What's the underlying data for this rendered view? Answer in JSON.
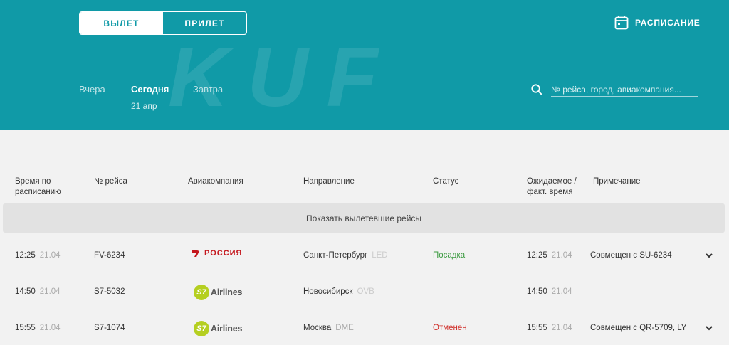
{
  "header": {
    "bg_logo": "KUF",
    "tabs": [
      {
        "label": "ВЫЛЕТ",
        "active": true
      },
      {
        "label": "ПРИЛЕТ",
        "active": false
      }
    ],
    "schedule_label": "РАСПИСАНИЕ",
    "days": {
      "yesterday": "Вчера",
      "today": "Сегодня",
      "tomorrow": "Завтра",
      "today_date": "21 апр"
    },
    "search_placeholder": "№ рейса, город, авиакомпания..."
  },
  "table": {
    "columns": {
      "scheduled_time": "Время по расписанию",
      "flight_number": "№ рейса",
      "airline": "Авиакомпания",
      "destination": "Направление",
      "status": "Статус",
      "expected_time": "Ожидаемое / факт. время",
      "note": "Примечание"
    },
    "show_departed": "Показать вылетевшие рейсы",
    "rows": [
      {
        "time": "12:25",
        "date": "21.04",
        "flight": "FV-6234",
        "airline_logo": "РОССИЯ",
        "city": "Санкт-Петербург",
        "code": "LED",
        "status": "Посадка",
        "exp_time": "12:25",
        "exp_date": "21.04",
        "note": "Совмещен с SU-6234"
      },
      {
        "time": "14:50",
        "date": "21.04",
        "flight": "S7-5032",
        "airline_logo": "Airlines",
        "airline_mark": "S7",
        "city": "Новосибирск",
        "code": "OVB",
        "status": "",
        "exp_time": "14:50",
        "exp_date": "21.04",
        "note": ""
      },
      {
        "time": "15:55",
        "date": "21.04",
        "flight": "S7-1074",
        "airline_logo": "Airlines",
        "airline_mark": "S7",
        "city": "Москва",
        "code": "DME",
        "status": "Отменен",
        "exp_time": "15:55",
        "exp_date": "21.04",
        "note": "Совмещен с QR-5709, LY"
      }
    ]
  },
  "colors": {
    "header_bg": "#109aa7",
    "status_ok": "#3a9a3f",
    "status_cancel": "#d0302b",
    "s7_green": "#b5cf21",
    "rossiya_red": "#c4161c"
  }
}
